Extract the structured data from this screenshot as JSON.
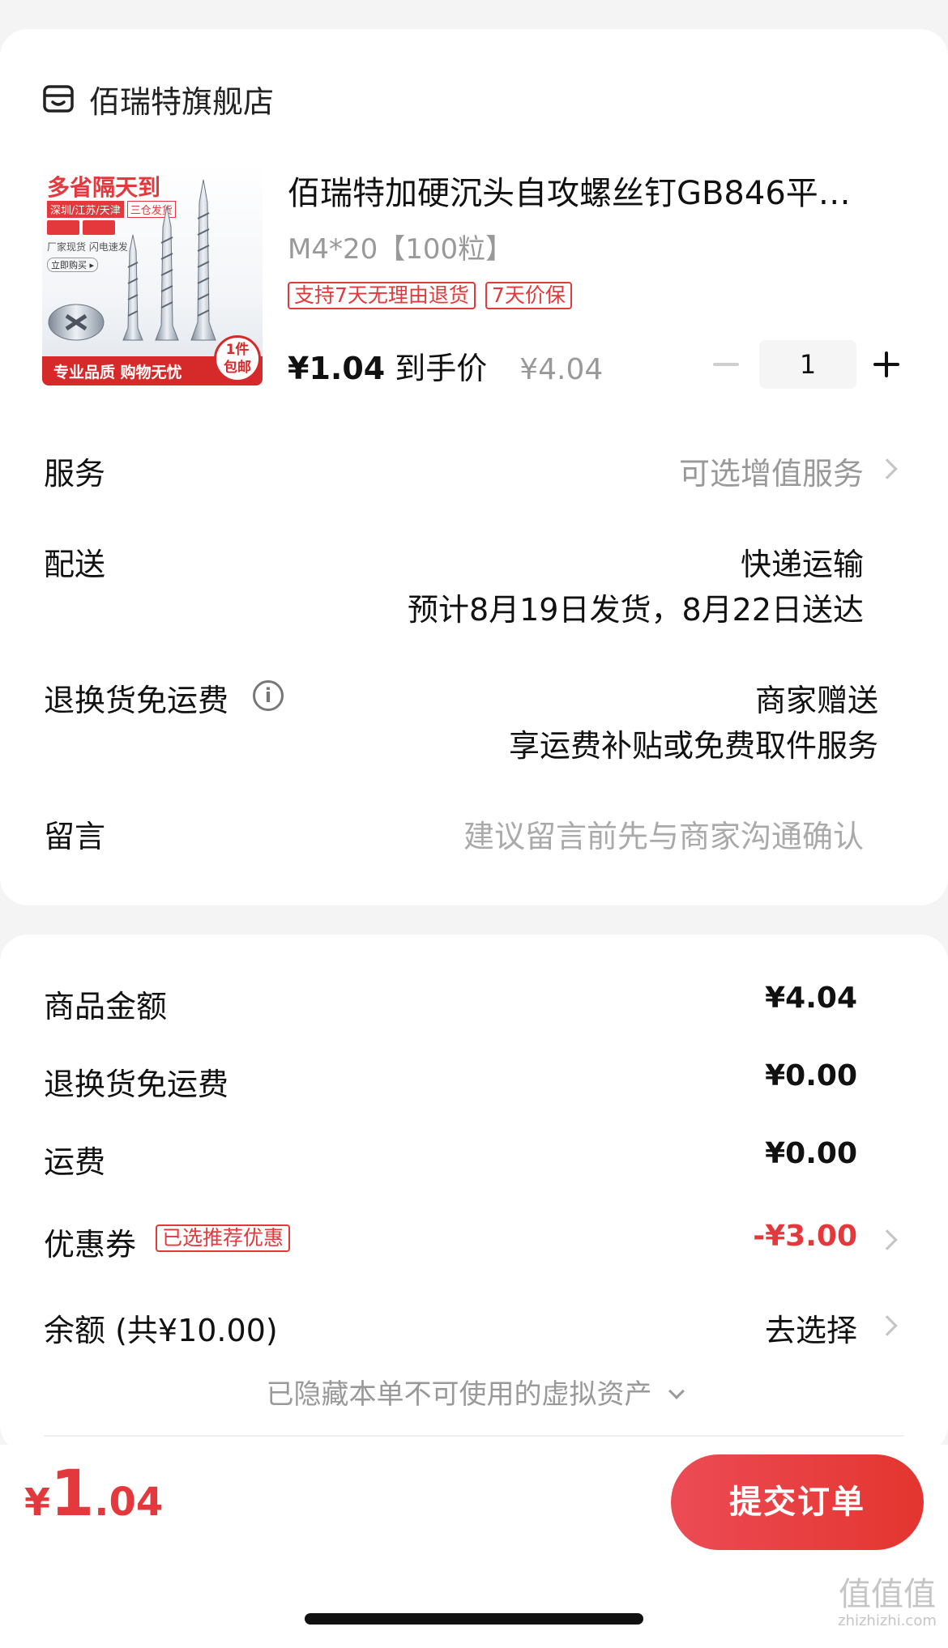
{
  "store": {
    "name": "佰瑞特旗舰店",
    "icon": "store-icon"
  },
  "product": {
    "title": "佰瑞特加硬沉头自攻螺丝钉GB846平…",
    "spec": "M4*20【100粒】",
    "tags": [
      "支持7天无理由退货",
      "7天价保"
    ],
    "final_price": "¥1.04",
    "final_price_label": "到手价",
    "original_price": "¥4.04",
    "quantity": "1",
    "image": {
      "headline": "多省隔天到",
      "sub": "深圳/江苏/天津",
      "sub2": "三仓发货",
      "line": "厂家现货 闪电速发",
      "btn": "立即购买 ▸",
      "footer": "专业品质 购物无忧",
      "badge_top": "1件",
      "badge_bottom": "包邮"
    }
  },
  "rows": {
    "service": {
      "label": "服务",
      "value": "可选增值服务"
    },
    "delivery": {
      "label": "配送",
      "method": "快递运输",
      "schedule": "预计8月19日发货，8月22日送达"
    },
    "return_freight": {
      "label": "退换货免运费",
      "value": "商家赠送",
      "sub": "享运费补贴或免费取件服务"
    },
    "message": {
      "label": "留言",
      "placeholder": "建议留言前先与商家沟通确认"
    }
  },
  "summary": {
    "goods_amount": {
      "label": "商品金额",
      "value": "¥4.04"
    },
    "return_freight": {
      "label": "退换货免运费",
      "value": "¥0.00"
    },
    "shipping": {
      "label": "运费",
      "value": "¥0.00"
    },
    "coupon": {
      "label": "优惠券",
      "tag": "已选推荐优惠",
      "value": "-¥3.00"
    },
    "balance": {
      "label": "余额 (共¥10.00)",
      "value": "去选择"
    },
    "hidden_assets": "已隐藏本单不可使用的虚拟资产"
  },
  "footer": {
    "currency": "¥",
    "total_int": "1",
    "total_dec": ".04",
    "submit_label": "提交订单"
  },
  "watermark": {
    "text": "值值值",
    "url": "zhizhizhi.com"
  },
  "colors": {
    "accent": "#e4393c",
    "button_start": "#ec4b55",
    "button_end": "#e4352f"
  }
}
